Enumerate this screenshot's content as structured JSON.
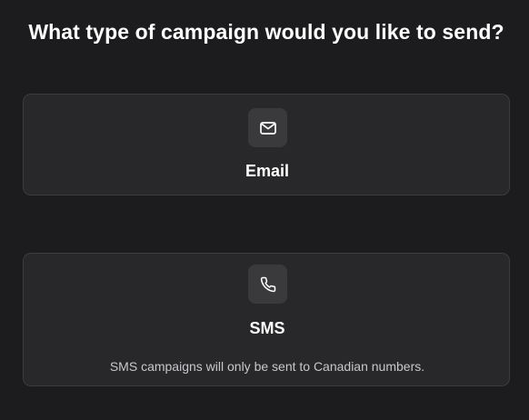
{
  "page": {
    "title": "What type of campaign would you like to send?"
  },
  "options": {
    "email": {
      "label": "Email",
      "icon": "envelope-icon"
    },
    "sms": {
      "label": "SMS",
      "icon": "phone-icon",
      "description": "SMS campaigns will only be sent to Canadian numbers."
    }
  },
  "colors": {
    "background": "#1c1c1e",
    "card": "#28282a",
    "card_border": "#3c3c3f",
    "icon_box": "#3a3a3d",
    "text": "#ffffff",
    "muted_text": "#c8c8cc"
  }
}
